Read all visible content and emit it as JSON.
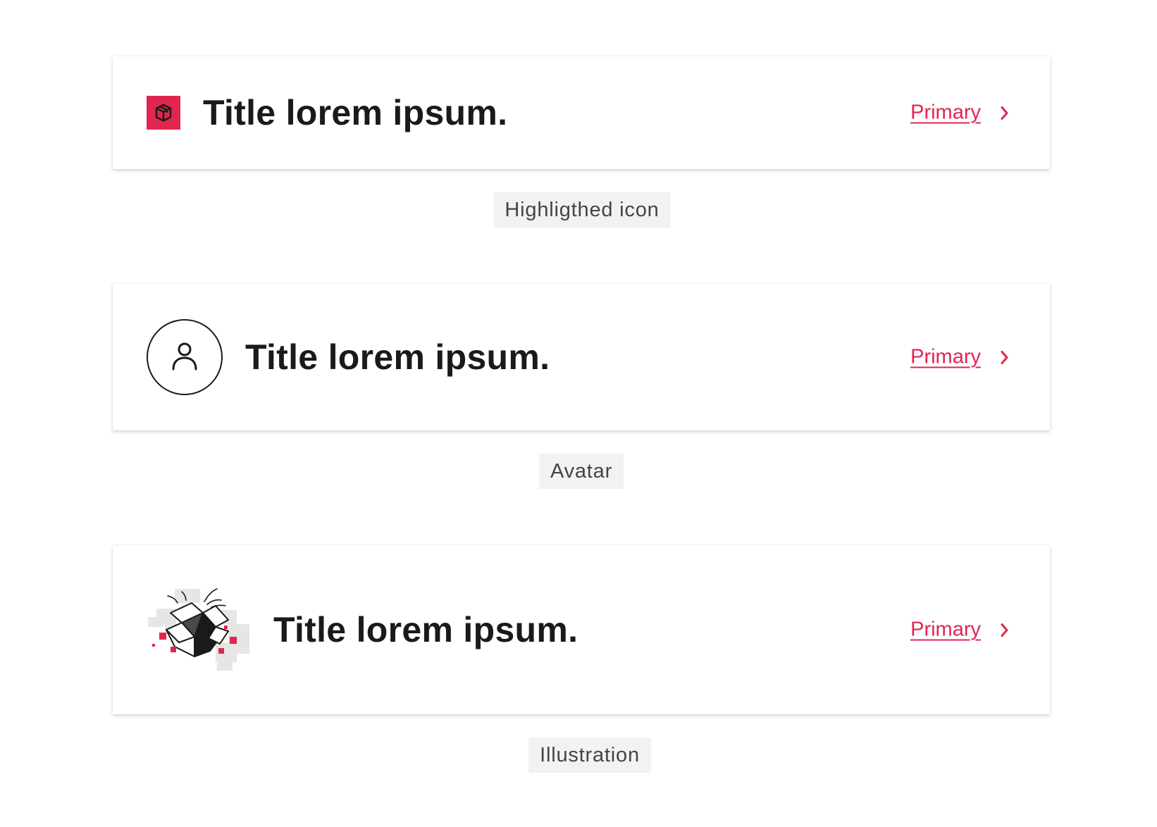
{
  "colors": {
    "accent": "#e0264f",
    "text": "#1a1a1a",
    "caption_bg": "#f2f2f2",
    "caption_text": "#444444",
    "illustration_gray": "#e6e6e6"
  },
  "cards": [
    {
      "media_type": "highlighted-icon",
      "icon": "box-icon",
      "title": "Title lorem ipsum.",
      "action_label": "Primary",
      "action_icon": "chevron-right-icon",
      "caption": "Highligthed icon"
    },
    {
      "media_type": "avatar",
      "icon": "user-icon",
      "title": "Title lorem ipsum.",
      "action_label": "Primary",
      "action_icon": "chevron-right-icon",
      "caption": "Avatar"
    },
    {
      "media_type": "illustration",
      "icon": "open-box-illustration",
      "title": "Title lorem ipsum.",
      "action_label": "Primary",
      "action_icon": "chevron-right-icon",
      "caption": "Illustration"
    }
  ]
}
